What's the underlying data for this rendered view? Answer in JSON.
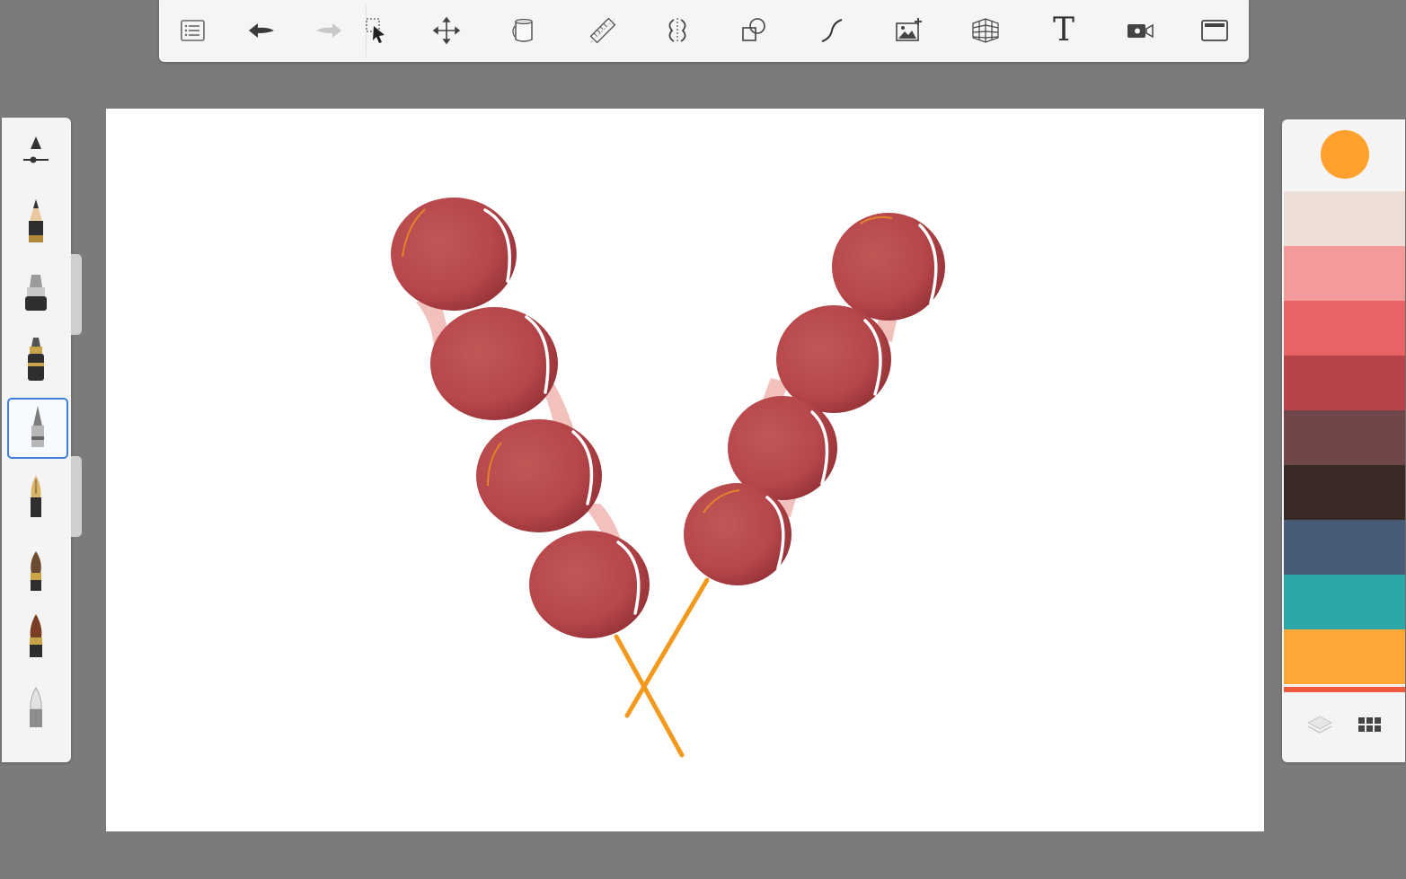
{
  "toolbar": {
    "icons": [
      "menu-icon",
      "undo-icon",
      "redo-icon",
      "select-icon",
      "transform-icon",
      "fill-icon",
      "ruler-icon",
      "symmetry-icon",
      "shape-icon",
      "curve-icon",
      "image-add-icon",
      "perspective-icon",
      "text-icon",
      "record-icon",
      "fullscreen-icon"
    ],
    "text_tool_glyph": "T"
  },
  "brushes": {
    "items": [
      "brush-settings",
      "pencil",
      "marker",
      "airbrush",
      "technical-pen",
      "fountain-pen",
      "paint-brush",
      "ink-brush",
      "eraser"
    ],
    "selected_index": 4
  },
  "palette": {
    "current_color": "#ffa12c",
    "swatches": [
      "#eddfd6",
      "#f49a9a",
      "#e86363",
      "#b84349",
      "#714648",
      "#3a2a26",
      "#485b77",
      "#2aa7a6",
      "#ffa737"
    ],
    "bottom_icons": [
      "layers-icon",
      "grid-icon"
    ]
  },
  "artwork": {
    "berry_color": "#b6464a",
    "berry_shadow": "#8f3035",
    "stick_color": "#f39a1e",
    "syrup_color": "#f0b5b2"
  }
}
